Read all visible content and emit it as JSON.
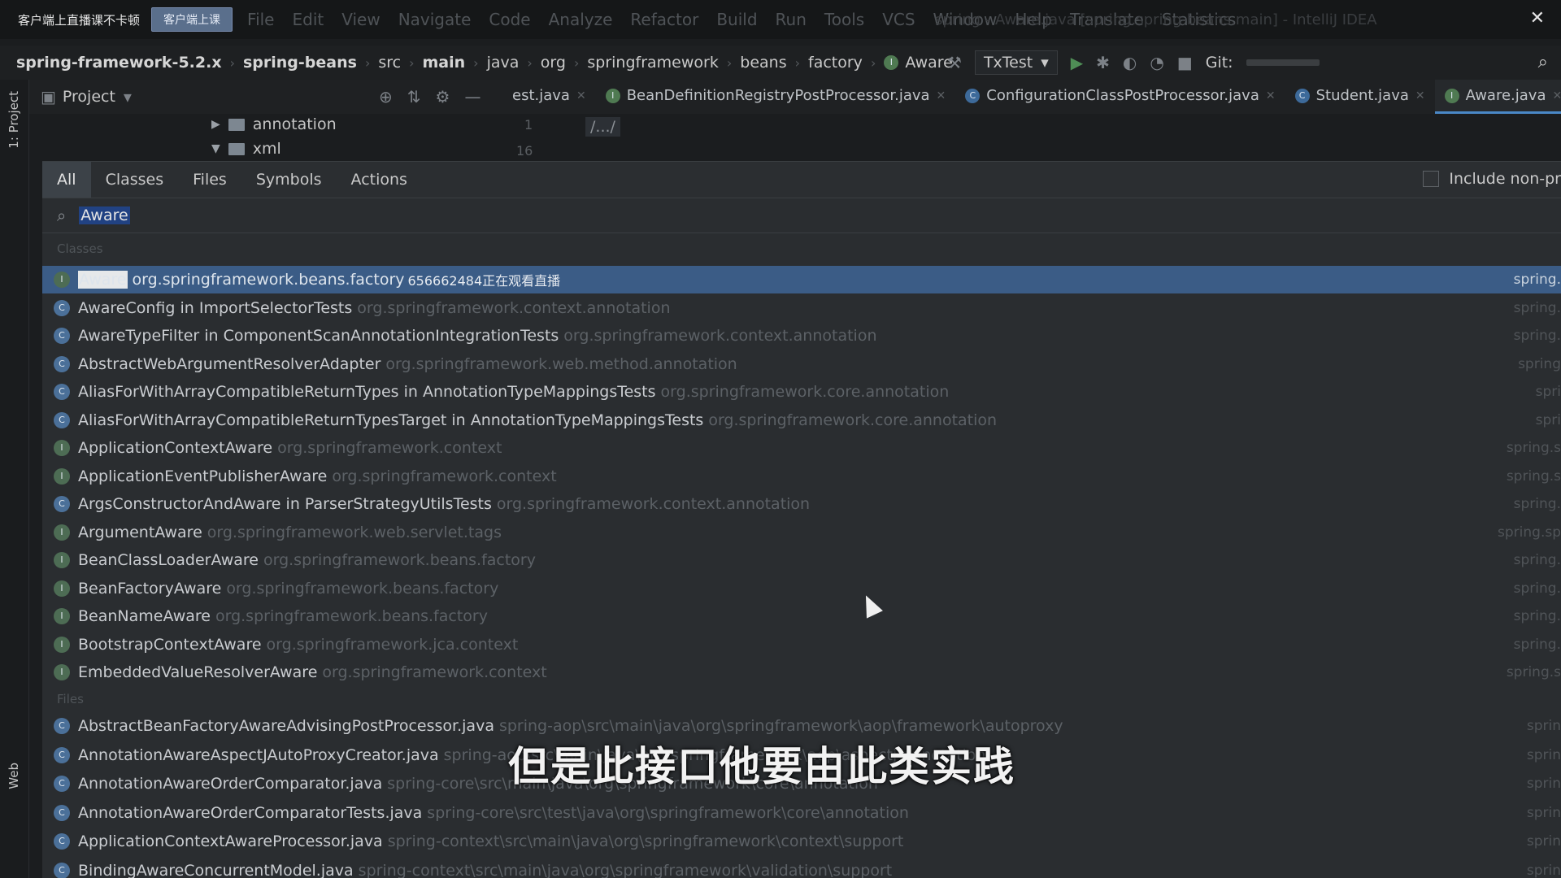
{
  "live": {
    "tag": "客户端上直播课不卡顿",
    "button": "客户端上课"
  },
  "menu": [
    "File",
    "Edit",
    "View",
    "Navigate",
    "Code",
    "Analyze",
    "Refactor",
    "Build",
    "Run",
    "Tools",
    "VCS",
    "Window",
    "Help",
    "Translate",
    "Statistics"
  ],
  "window_title": "spring - Aware.java [spring.spring-beans.main] - IntelliJ IDEA",
  "breadcrumb": [
    "spring-framework-5.2.x",
    "spring-beans",
    "src",
    "main",
    "java",
    "org",
    "springframework",
    "beans",
    "factory",
    "Aware"
  ],
  "toolbar": {
    "run_config": "TxTest",
    "git_label": "Git:"
  },
  "project_panel": {
    "title": "Project",
    "tree": [
      {
        "name": "annotation",
        "expanded": false
      },
      {
        "name": "xml",
        "expanded": true
      }
    ]
  },
  "side_labels": {
    "project": "1: Project",
    "web": "Web"
  },
  "editor_tabs": [
    {
      "label": "est.java",
      "icon": "class-icon"
    },
    {
      "label": "BeanDefinitionRegistryPostProcessor.java",
      "icon": "interface-icon"
    },
    {
      "label": "ConfigurationClassPostProcessor.java",
      "icon": "class-icon"
    },
    {
      "label": "Student.java",
      "icon": "class-icon"
    },
    {
      "label": "Aware.java",
      "icon": "interface-icon",
      "active": true
    }
  ],
  "editor": {
    "line_numbers": [
      "1",
      "16"
    ],
    "code": "/.../"
  },
  "search": {
    "tabs": [
      "All",
      "Classes",
      "Files",
      "Symbols",
      "Actions"
    ],
    "active_tab": "All",
    "query": "Aware",
    "include_label": "Include non-pr",
    "classes_label": "Classes",
    "files_label": "Files",
    "classes": [
      {
        "highlight": "Aware",
        "name": "",
        "pkg": "org.springframework.beans.factory",
        "viewer": "656662484正在观看直播",
        "module": "spring.",
        "icon": "interface",
        "selected": true
      },
      {
        "highlight": "",
        "name": "AwareConfig in ImportSelectorTests",
        "pkg": "org.springframework.context.annotation",
        "module": "spring.",
        "icon": "class"
      },
      {
        "highlight": "",
        "name": "AwareTypeFilter in ComponentScanAnnotationIntegrationTests",
        "pkg": "org.springframework.context.annotation",
        "module": "spring.",
        "icon": "class"
      },
      {
        "highlight": "",
        "name": "AbstractWebArgumentResolverAdapter",
        "pkg": "org.springframework.web.method.annotation",
        "module": "spring",
        "icon": "class"
      },
      {
        "highlight": "",
        "name": "AliasForWithArrayCompatibleReturnTypes in AnnotationTypeMappingsTests",
        "pkg": "org.springframework.core.annotation",
        "module": "spri",
        "icon": "class"
      },
      {
        "highlight": "",
        "name": "AliasForWithArrayCompatibleReturnTypesTarget in AnnotationTypeMappingsTests",
        "pkg": "org.springframework.core.annotation",
        "module": "spri",
        "icon": "class"
      },
      {
        "highlight": "",
        "name": "ApplicationContextAware",
        "pkg": "org.springframework.context",
        "module": "spring.s",
        "icon": "interface"
      },
      {
        "highlight": "",
        "name": "ApplicationEventPublisherAware",
        "pkg": "org.springframework.context",
        "module": "spring.s",
        "icon": "interface"
      },
      {
        "highlight": "",
        "name": "ArgsConstructorAndAware in ParserStrategyUtilsTests",
        "pkg": "org.springframework.context.annotation",
        "module": "spring.",
        "icon": "class"
      },
      {
        "highlight": "",
        "name": "ArgumentAware",
        "pkg": "org.springframework.web.servlet.tags",
        "module": "spring.sp",
        "icon": "interface"
      },
      {
        "highlight": "",
        "name": "BeanClassLoaderAware",
        "pkg": "org.springframework.beans.factory",
        "module": "spring.",
        "icon": "interface"
      },
      {
        "highlight": "",
        "name": "BeanFactoryAware",
        "pkg": "org.springframework.beans.factory",
        "module": "spring.",
        "icon": "interface"
      },
      {
        "highlight": "",
        "name": "BeanNameAware",
        "pkg": "org.springframework.beans.factory",
        "module": "spring.",
        "icon": "interface"
      },
      {
        "highlight": "",
        "name": "BootstrapContextAware",
        "pkg": "org.springframework.jca.context",
        "module": "spring.",
        "icon": "interface"
      },
      {
        "highlight": "",
        "name": "EmbeddedValueResolverAware",
        "pkg": "org.springframework.context",
        "module": "spring.s",
        "icon": "interface"
      }
    ],
    "files": [
      {
        "name": "AbstractBeanFactoryAwareAdvisingPostProcessor.java",
        "pkg": "spring-aop\\src\\main\\java\\org\\springframework\\aop\\framework\\autoproxy",
        "module": "sprin"
      },
      {
        "name": "AnnotationAwareAspectJAutoProxyCreator.java",
        "pkg": "spring-aop\\src\\main\\java\\org\\springframework\\aop\\aspectj\\annotation",
        "module": "sprin"
      },
      {
        "name": "AnnotationAwareOrderComparator.java",
        "pkg": "spring-core\\src\\main\\java\\org\\springframework\\core\\annotation",
        "module": "sprin"
      },
      {
        "name": "AnnotationAwareOrderComparatorTests.java",
        "pkg": "spring-core\\src\\test\\java\\org\\springframework\\core\\annotation",
        "module": "sprin"
      },
      {
        "name": "ApplicationContextAwareProcessor.java",
        "pkg": "spring-context\\src\\main\\java\\org\\springframework\\context\\support",
        "module": "sprin"
      },
      {
        "name": "BindingAwareConcurrentModel.java",
        "pkg": "spring-context\\src\\main\\java\\org\\springframework\\validation\\support",
        "module": "sprin"
      }
    ]
  },
  "subtitle": "但是此接口他要由此类实践"
}
